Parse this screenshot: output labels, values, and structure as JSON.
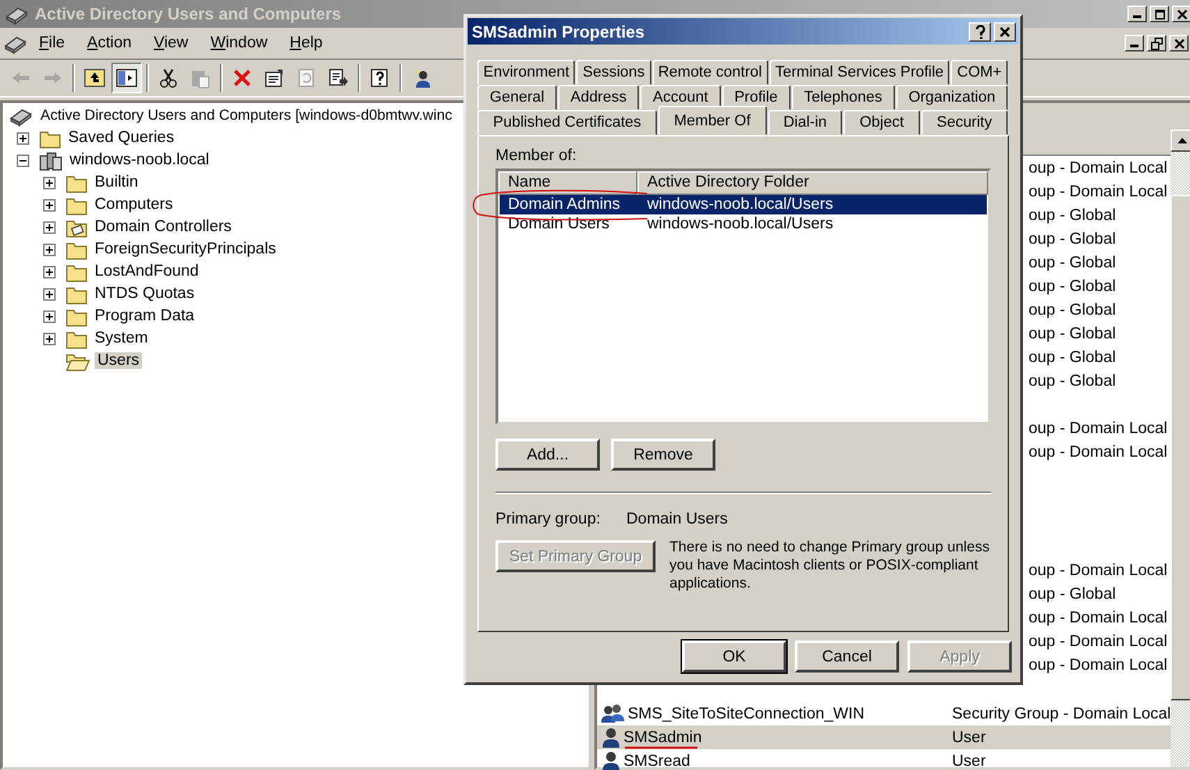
{
  "window": {
    "title": "Active Directory Users and Computers"
  },
  "menu": [
    "File",
    "Action",
    "View",
    "Window",
    "Help"
  ],
  "toolbar": [
    {
      "kind": "back",
      "disabled": true,
      "pressed": false
    },
    {
      "kind": "forward",
      "disabled": true,
      "pressed": false
    },
    {
      "kind": "up",
      "disabled": false,
      "pressed": false
    },
    {
      "kind": "tree",
      "disabled": false,
      "pressed": true
    },
    {
      "kind": "cut",
      "disabled": false,
      "pressed": false
    },
    {
      "kind": "paste",
      "disabled": true,
      "pressed": false
    },
    {
      "kind": "delete",
      "disabled": false,
      "pressed": false
    },
    {
      "kind": "properties",
      "disabled": false,
      "pressed": false
    },
    {
      "kind": "refresh",
      "disabled": true,
      "pressed": false
    },
    {
      "kind": "export",
      "disabled": false,
      "pressed": false
    },
    {
      "kind": "help",
      "disabled": false,
      "pressed": false
    },
    {
      "kind": "new-user",
      "disabled": false,
      "pressed": false
    }
  ],
  "tree": {
    "label": "Active Directory Users and Computers [windows-d0bmtwv.winc",
    "children": [
      {
        "label": "Saved Queries",
        "kind": "folder",
        "expanded": false,
        "selected": false
      },
      {
        "label": "windows-noob.local",
        "kind": "domain",
        "expanded": true,
        "selected": false,
        "children": [
          {
            "label": "Builtin",
            "kind": "folder",
            "expanded": false,
            "selected": false
          },
          {
            "label": "Computers",
            "kind": "folder",
            "expanded": false,
            "selected": false
          },
          {
            "label": "Domain Controllers",
            "kind": "dc-folder",
            "expanded": false,
            "selected": false
          },
          {
            "label": "ForeignSecurityPrincipals",
            "kind": "folder",
            "expanded": false,
            "selected": false
          },
          {
            "label": "LostAndFound",
            "kind": "folder",
            "expanded": false,
            "selected": false
          },
          {
            "label": "NTDS Quotas",
            "kind": "folder",
            "expanded": false,
            "selected": false
          },
          {
            "label": "Program Data",
            "kind": "folder",
            "expanded": false,
            "selected": false
          },
          {
            "label": "System",
            "kind": "folder",
            "expanded": false,
            "selected": false
          },
          {
            "label": "Users",
            "kind": "open-folder",
            "selected": true
          }
        ]
      }
    ]
  },
  "list": {
    "rows": [
      {
        "kind": "covered",
        "type": "oup - Domain Local"
      },
      {
        "kind": "covered",
        "type": "oup - Domain Local"
      },
      {
        "kind": "covered",
        "type": "oup - Global"
      },
      {
        "kind": "covered",
        "type": "oup - Global"
      },
      {
        "kind": "covered",
        "type": "oup - Global"
      },
      {
        "kind": "covered",
        "type": "oup - Global"
      },
      {
        "kind": "covered",
        "type": "oup - Global"
      },
      {
        "kind": "covered",
        "type": "oup - Global"
      },
      {
        "kind": "covered",
        "type": "oup - Global"
      },
      {
        "kind": "covered",
        "type": "oup - Global"
      },
      {
        "kind": "blank"
      },
      {
        "kind": "covered",
        "type": "oup - Domain Local"
      },
      {
        "kind": "covered",
        "type": "oup - Domain Local"
      },
      {
        "kind": "blank"
      },
      {
        "kind": "blank"
      },
      {
        "kind": "blank"
      },
      {
        "kind": "blank"
      },
      {
        "kind": "covered",
        "type": "oup - Domain Local"
      },
      {
        "kind": "covered",
        "type": "oup - Global"
      },
      {
        "kind": "covered",
        "type": "oup - Domain Local"
      },
      {
        "kind": "covered",
        "type": "oup - Domain Local"
      },
      {
        "kind": "covered",
        "type": "oup - Domain Local"
      },
      {
        "kind": "blank"
      },
      {
        "kind": "group",
        "name": "SMS_SiteToSiteConnection_WIN",
        "type": "Security Group - Domain Local",
        "selected": false
      },
      {
        "kind": "user",
        "name": "SMSadmin",
        "type": "User",
        "selected": true
      },
      {
        "kind": "user",
        "name": "SMSread",
        "type": "User",
        "selected": false
      }
    ]
  },
  "dialog": {
    "title": "SMSadmin Properties",
    "tab_rows": [
      [
        {
          "label": "Environment",
          "selected": false
        },
        {
          "label": "Sessions",
          "selected": false
        },
        {
          "label": "Remote control",
          "selected": false
        },
        {
          "label": "Terminal Services Profile",
          "selected": false
        },
        {
          "label": "COM+",
          "selected": false
        }
      ],
      [
        {
          "label": "General",
          "selected": false
        },
        {
          "label": "Address",
          "selected": false
        },
        {
          "label": "Account",
          "selected": false
        },
        {
          "label": "Profile",
          "selected": false
        },
        {
          "label": "Telephones",
          "selected": false
        },
        {
          "label": "Organization",
          "selected": false
        }
      ],
      [
        {
          "label": "Published Certificates",
          "selected": false
        },
        {
          "label": "Member Of",
          "selected": true
        },
        {
          "label": "Dial-in",
          "selected": false
        },
        {
          "label": "Object",
          "selected": false
        },
        {
          "label": "Security",
          "selected": false
        }
      ]
    ],
    "member_of_label": "Member of:",
    "columns": [
      "Name",
      "Active Directory Folder"
    ],
    "groups": [
      {
        "name": "Domain Admins",
        "folder": "windows-noob.local/Users",
        "selected": true
      },
      {
        "name": "Domain Users",
        "folder": "windows-noob.local/Users",
        "selected": false
      }
    ],
    "list_buttons": [
      {
        "label": "Add...",
        "disabled": false
      },
      {
        "label": "Remove",
        "disabled": false
      }
    ],
    "primary_group_label": "Primary group:",
    "primary_group": "Domain Users",
    "set_primary": {
      "label": "Set Primary Group",
      "disabled": true
    },
    "note": "There is no need to change Primary group unless you have Macintosh clients or POSIX-compliant applications.",
    "footer_buttons": [
      {
        "label": "OK",
        "disabled": false
      },
      {
        "label": "Cancel",
        "disabled": false
      },
      {
        "label": "Apply",
        "disabled": true
      }
    ]
  }
}
